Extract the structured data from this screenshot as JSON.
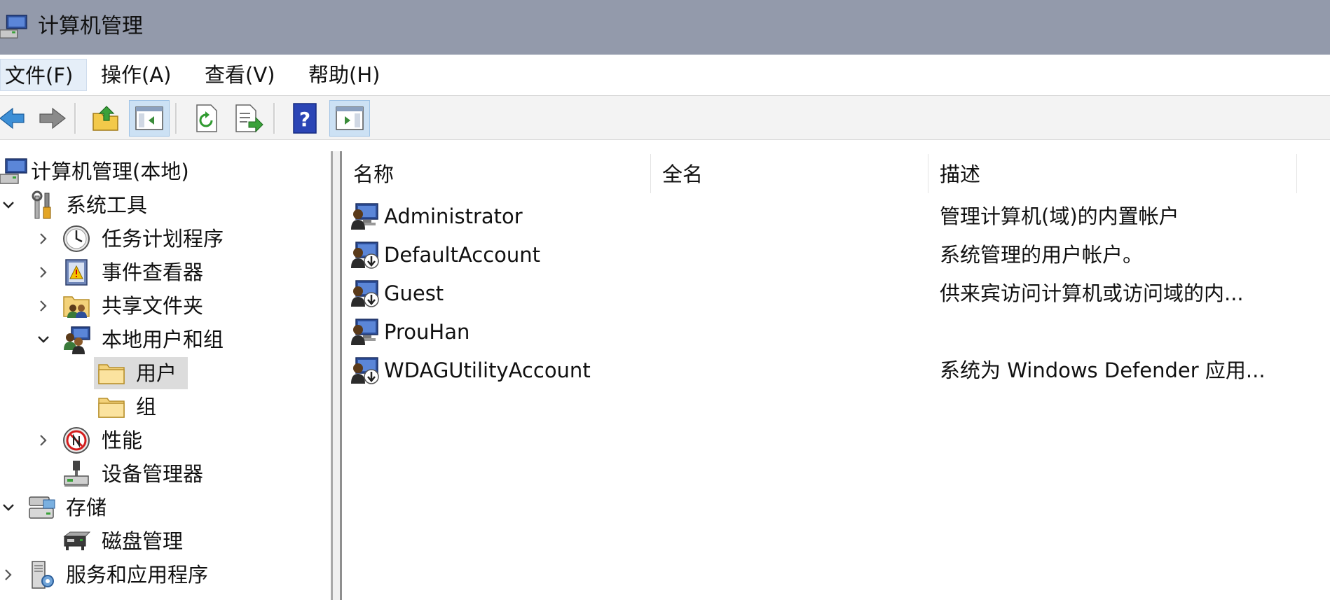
{
  "window": {
    "title": "计算机管理"
  },
  "menu": {
    "items": [
      {
        "label": "文件(F)"
      },
      {
        "label": "操作(A)"
      },
      {
        "label": "查看(V)"
      },
      {
        "label": "帮助(H)"
      }
    ]
  },
  "toolbar": {
    "buttons": [
      {
        "icon": "back-arrow-icon"
      },
      {
        "icon": "forward-arrow-icon"
      },
      {
        "icon": "up-folder-icon"
      },
      {
        "icon": "show-hide-console-tree-icon"
      },
      {
        "icon": "refresh-icon"
      },
      {
        "icon": "export-list-icon"
      },
      {
        "icon": "help-icon"
      },
      {
        "icon": "show-hide-action-pane-icon"
      }
    ]
  },
  "tree": {
    "root": "计算机管理(本地)",
    "system_tools": "系统工具",
    "task_scheduler": "任务计划程序",
    "event_viewer": "事件查看器",
    "shared_folders": "共享文件夹",
    "local_users_groups": "本地用户和组",
    "users": "用户",
    "groups": "组",
    "performance": "性能",
    "device_manager": "设备管理器",
    "storage": "存储",
    "disk_management": "磁盘管理",
    "services_apps": "服务和应用程序"
  },
  "list": {
    "columns": [
      "名称",
      "全名",
      "描述"
    ],
    "rows": [
      {
        "name": "Administrator",
        "fullname": "",
        "description": "管理计算机(域)的内置帐户",
        "icon": "user-icon"
      },
      {
        "name": "DefaultAccount",
        "fullname": "",
        "description": "系统管理的用户帐户。",
        "icon": "disabled-user-icon"
      },
      {
        "name": "Guest",
        "fullname": "",
        "description": "供来宾访问计算机或访问域的内...",
        "icon": "disabled-user-icon"
      },
      {
        "name": "ProuHan",
        "fullname": "",
        "description": "",
        "icon": "user-icon"
      },
      {
        "name": "WDAGUtilityAccount",
        "fullname": "",
        "description": "系统为 Windows Defender 应用...",
        "icon": "disabled-user-icon"
      }
    ]
  }
}
